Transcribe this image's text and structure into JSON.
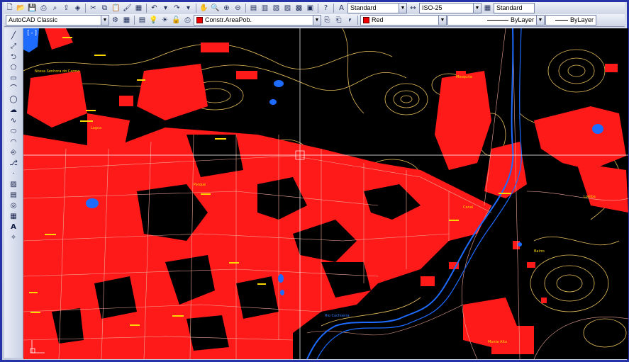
{
  "toolbar": {
    "text_style": "Standard",
    "dim_style": "ISO-25",
    "table_style": "Standard",
    "workspace": "AutoCAD Classic",
    "layer": "Constr.AreaPob.",
    "color": "Red",
    "linetype": "ByLayer",
    "lineweight": "ByLayer",
    "color_hex": "#e00000"
  },
  "viewport": {
    "label": "[-]"
  },
  "map_labels": [
    "Nossa Senhora do Carmo",
    "Mesquita",
    "Lagoa",
    "Rio Cachoeira",
    "Canal",
    "Bairro",
    "Parque",
    "Monte Alto",
    "Lomba"
  ],
  "colors": {
    "background": "#000000",
    "built_area": "#ff1a1a",
    "contour": "#f0c85a",
    "road": "#e8a088",
    "water": "#1e6bff",
    "label": "#ffd700"
  }
}
